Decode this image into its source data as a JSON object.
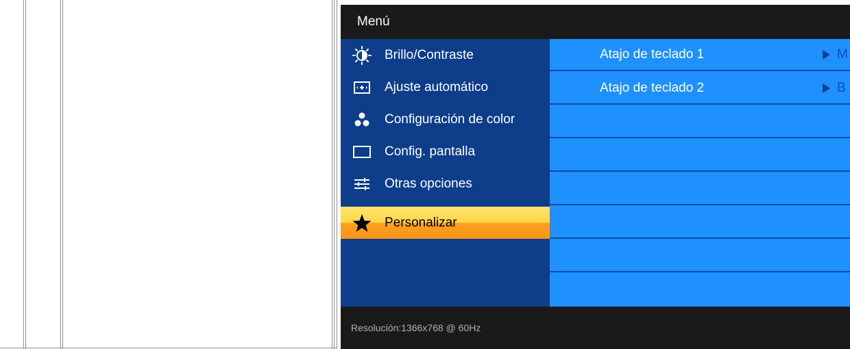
{
  "osd": {
    "title": "Menú",
    "menu": [
      {
        "label": "Brillo/Contraste",
        "icon": "brightness-contrast-icon"
      },
      {
        "label": "Ajuste automático",
        "icon": "auto-adjust-icon"
      },
      {
        "label": "Configuración de color",
        "icon": "color-settings-icon"
      },
      {
        "label": "Config. pantalla",
        "icon": "display-settings-icon"
      },
      {
        "label": "Otras opciones",
        "icon": "other-settings-icon"
      },
      {
        "label": "Personalizar",
        "icon": "star-icon",
        "selected": true
      }
    ],
    "submenu": [
      {
        "label": "Atajo de teclado 1",
        "value": "M"
      },
      {
        "label": "Atajo de teclado 2",
        "value": "B"
      }
    ],
    "footer": "Resolución:1366x768 @ 60Hz"
  },
  "colors": {
    "left_panel": "#0e3d8a",
    "right_panel": "#1e90ff",
    "selected_top": "#ffe36b",
    "selected_bottom": "#f7961a",
    "osd_frame": "#1a1a1a"
  }
}
